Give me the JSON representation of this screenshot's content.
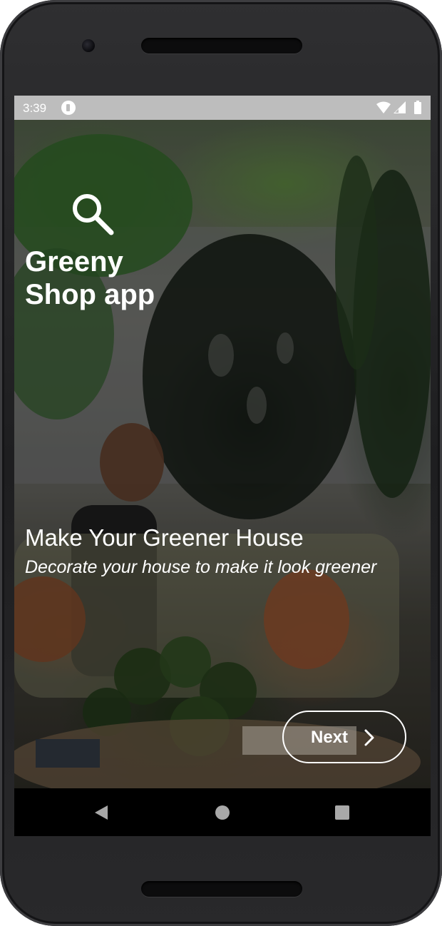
{
  "status_bar": {
    "time": "3:39",
    "icons": [
      "notification-app-icon",
      "wifi-icon",
      "signal-icon",
      "battery-icon"
    ]
  },
  "app": {
    "title_line1": "Greeny",
    "title_line2": "Shop app",
    "tagline": "Make Your Greener House",
    "subtitle": "Decorate your house to make it look greener",
    "next_label": "Next"
  },
  "nav_bar": {
    "icons": [
      "back-icon",
      "home-icon",
      "recents-icon"
    ]
  },
  "colors": {
    "text": "#ffffff",
    "status_bar_bg": "#bdbdbd",
    "nav_bar_bg": "#000000",
    "nav_icon": "#a8a8a8"
  }
}
